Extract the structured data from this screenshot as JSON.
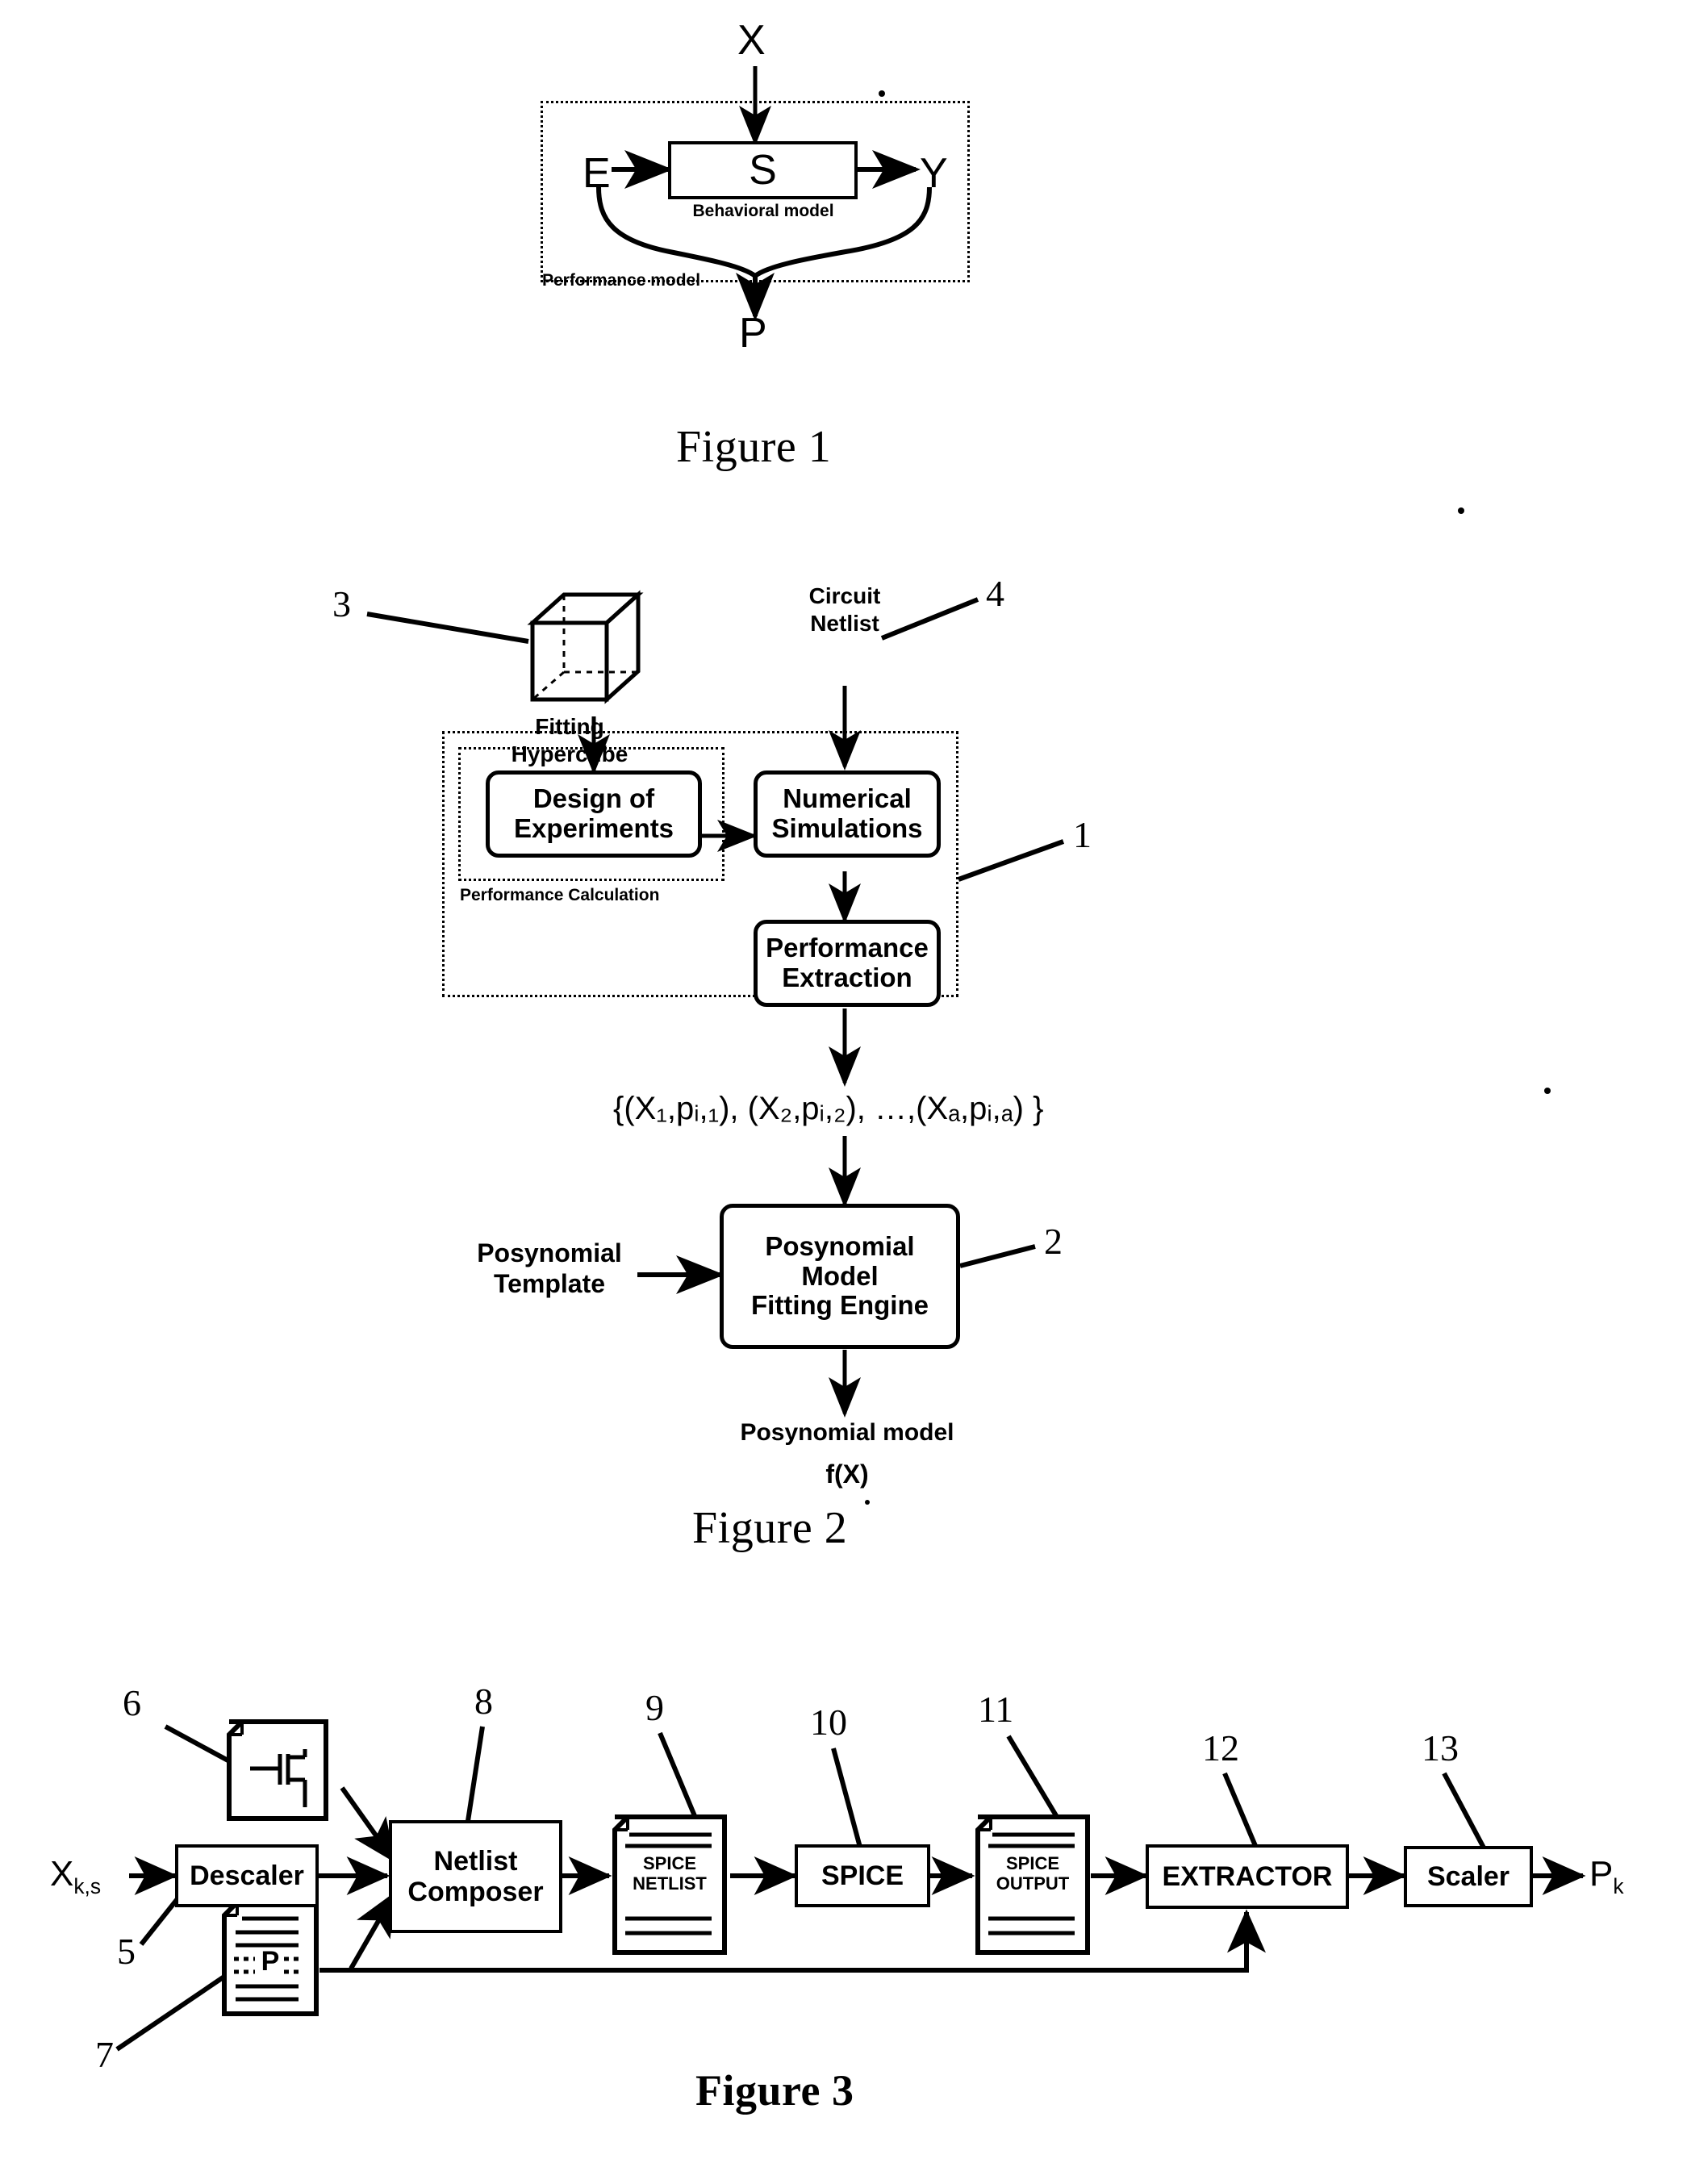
{
  "figure1": {
    "caption": "Figure 1",
    "inputs": {
      "x": "X",
      "e": "E"
    },
    "outputs": {
      "y": "Y",
      "p": "P"
    },
    "system_block": "S",
    "inner_frame_label": "Behavioral model",
    "outer_frame_label": "Performance model"
  },
  "figure2": {
    "caption": "Figure 2",
    "hypercube_label": "Fitting Hypercube",
    "netlist_label": "Circuit\nNetlist",
    "blocks": {
      "doe": "Design of\nExperiments",
      "numsim": "Numerical\nSimulations",
      "perfext": "Performance\nExtraction",
      "fitting_engine": "Posynomial\nModel\nFitting Engine"
    },
    "inner_dashed_label": "Performance Calculation",
    "dataset_formula": "{(X₁,pᵢ,₁), (X₂,pᵢ,₂), …,(Xₐ,pᵢ,ₐ) }",
    "template_label": "Posynomial\nTemplate",
    "output_label": "Posynomial model",
    "output_function": "f(X)",
    "refs": {
      "hypercube": "3",
      "netlist": "4",
      "perf_calc_group": "1",
      "fitting_engine": "2"
    }
  },
  "figure3": {
    "caption": "Figure 3",
    "input_var": "X",
    "input_var_sub": "k,s",
    "output_var": "P",
    "output_var_sub": "k",
    "blocks": {
      "descaler": "Descaler",
      "netlist_composer": "Netlist\nComposer",
      "spice_netlist": "SPICE\nNETLIST",
      "spice": "SPICE",
      "spice_output": "SPICE\nOUTPUT",
      "extractor": "EXTRACTOR",
      "scaler": "Scaler"
    },
    "doc_p_label": "P",
    "refs": {
      "descaler": "5",
      "transistor_doc": "6",
      "performance_doc": "7",
      "netlist_composer": "8",
      "spice_netlist": "9",
      "spice": "10",
      "spice_output": "11",
      "extractor": "12",
      "scaler": "13"
    },
    "icons": {
      "transistor_doc": "transistor-schematic-document-icon",
      "performance_doc": "performance-document-icon",
      "spice_netlist_doc": "spice-netlist-document-icon",
      "spice_output_doc": "spice-output-document-icon"
    }
  },
  "colors": {
    "ink": "#000000",
    "paper": "#ffffff"
  }
}
